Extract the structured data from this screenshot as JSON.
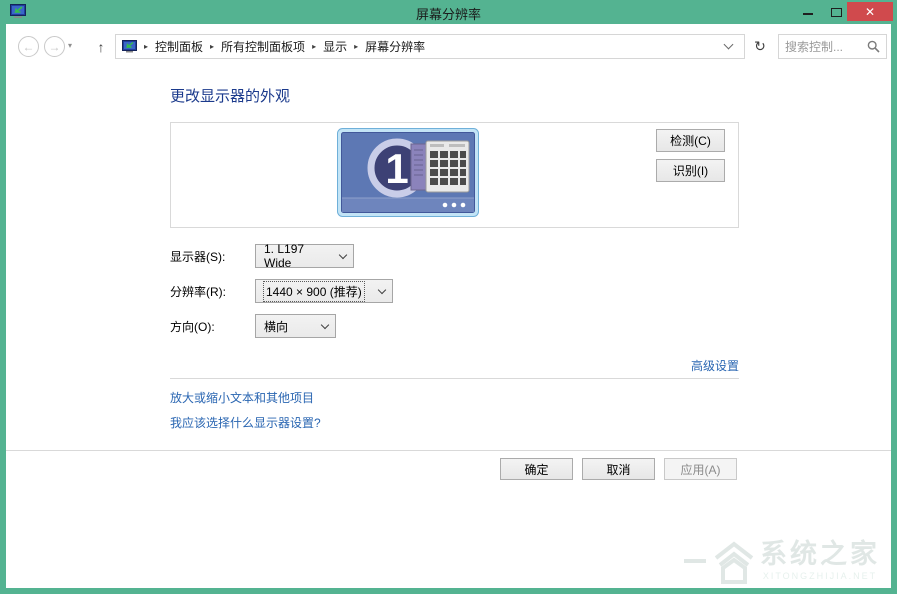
{
  "window": {
    "title": "屏幕分辨率",
    "close_glyph": "✕"
  },
  "icons": {
    "back": "←",
    "forward": "→",
    "history_dropdown": "▾",
    "up": "↑",
    "refresh": "↻"
  },
  "toolbar": {
    "breadcrumb": {
      "separator": "▸",
      "items": [
        "控制面板",
        "所有控制面板项",
        "显示",
        "屏幕分辨率"
      ]
    },
    "search_placeholder": "搜索控制..."
  },
  "main": {
    "heading": "更改显示器的外观",
    "preview": {
      "monitor_number": "1",
      "detect": "检测(C)",
      "identify": "识别(I)"
    },
    "form": {
      "display_label": "显示器(S):",
      "display_value": "1. L197 Wide",
      "resolution_label": "分辨率(R):",
      "resolution_value": "1440 × 900 (推荐)",
      "orientation_label": "方向(O):",
      "orientation_value": "横向"
    },
    "links": {
      "advanced": "高级设置",
      "resize_text": "放大或缩小文本和其他项目",
      "help": "我应该选择什么显示器设置?"
    },
    "buttons": {
      "ok": "确定",
      "cancel": "取消",
      "apply": "应用(A)"
    }
  },
  "watermark": {
    "name": "系统之家",
    "domain": "XITONGZHIJIA.NET"
  },
  "colors": {
    "titlebar": "#54b391",
    "close_button": "#d04a4d",
    "link": "#2a66b2",
    "heading": "#1b3a8c",
    "monitor_screen": "#5d78b4"
  }
}
